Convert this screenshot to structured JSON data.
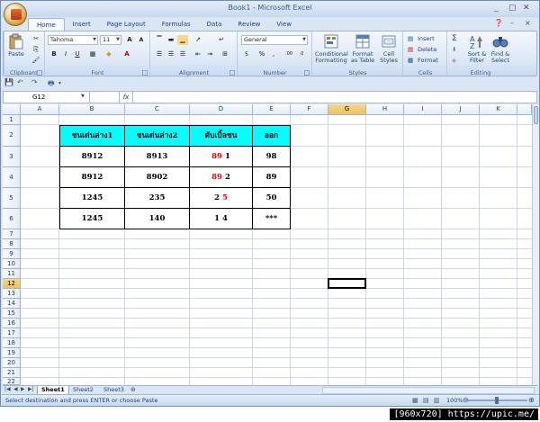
{
  "window": {
    "title": "Book1 - Microsoft Excel",
    "controls": [
      "_",
      "▢",
      "✕"
    ]
  },
  "tabs": [
    "Home",
    "Insert",
    "Page Layout",
    "Formulas",
    "Data",
    "Review",
    "View"
  ],
  "ribbon": {
    "clipboard": {
      "label": "Clipboard",
      "paste": "Paste"
    },
    "font": {
      "label": "Font",
      "name": "Tahoma",
      "size": "11",
      "bold": "B",
      "italic": "I",
      "underline": "U",
      "grow": "A",
      "shrink": "A"
    },
    "alignment": {
      "label": "Alignment"
    },
    "number": {
      "label": "Number",
      "format": "General",
      "currency": "$",
      "percent": "%",
      "comma": ",",
      "inc_dec": ".00",
      "dec_dec": ".0"
    },
    "styles": {
      "label": "Styles",
      "conditional": [
        "Conditional",
        "Formatting"
      ],
      "format_table": [
        "Format",
        "as Table"
      ],
      "cell_styles": [
        "Cell",
        "Styles"
      ]
    },
    "cells": {
      "label": "Cells",
      "insert": "Insert",
      "delete": "Delete",
      "format": "Format"
    },
    "editing": {
      "label": "Editing",
      "sigma": "Σ",
      "sort": [
        "Sort &",
        "Filter"
      ],
      "find": [
        "Find &",
        "Select"
      ]
    }
  },
  "formula_bar": {
    "name_box": "G12",
    "fx": "fx",
    "value": ""
  },
  "columns": [
    "A",
    "B",
    "C",
    "D",
    "E",
    "F",
    "G",
    "H",
    "I",
    "J",
    "K"
  ],
  "rows": [
    "1",
    "2",
    "3",
    "4",
    "5",
    "6",
    "7",
    "8",
    "9",
    "10",
    "11",
    "12",
    "13",
    "14",
    "15",
    "16",
    "17",
    "18",
    "19",
    "20",
    "21",
    "22"
  ],
  "selected": {
    "column": "G",
    "row": "12"
  },
  "table": {
    "headers": [
      "ชนเด่นล่าง1",
      "ชนเด่นล่าง2",
      "ดับเบิ้ลชน",
      "ออก"
    ],
    "rows": [
      {
        "b": "8912",
        "c": "8913",
        "d_red": "89",
        "d_black": "1",
        "e": "98"
      },
      {
        "b": "8912",
        "c": "8902",
        "d_red": "89",
        "d_black": "2",
        "e": "89"
      },
      {
        "b": "1245",
        "c": "235",
        "d_black_first": "2",
        "d_red_last": "5",
        "e": "50"
      },
      {
        "b": "1245",
        "c": "140",
        "d_plain": "1 4",
        "e": "***"
      }
    ]
  },
  "sheets": [
    "Sheet1",
    "Sheet2",
    "Sheet3"
  ],
  "status": {
    "message": "Select destination and press ENTER or choose Paste",
    "zoom": "100%"
  },
  "caption": "[960x720] https://upic.me/",
  "colors": {
    "header_fill": "#00ffff",
    "red_text": "#ff0000",
    "ribbon_blue": "#15428b"
  }
}
